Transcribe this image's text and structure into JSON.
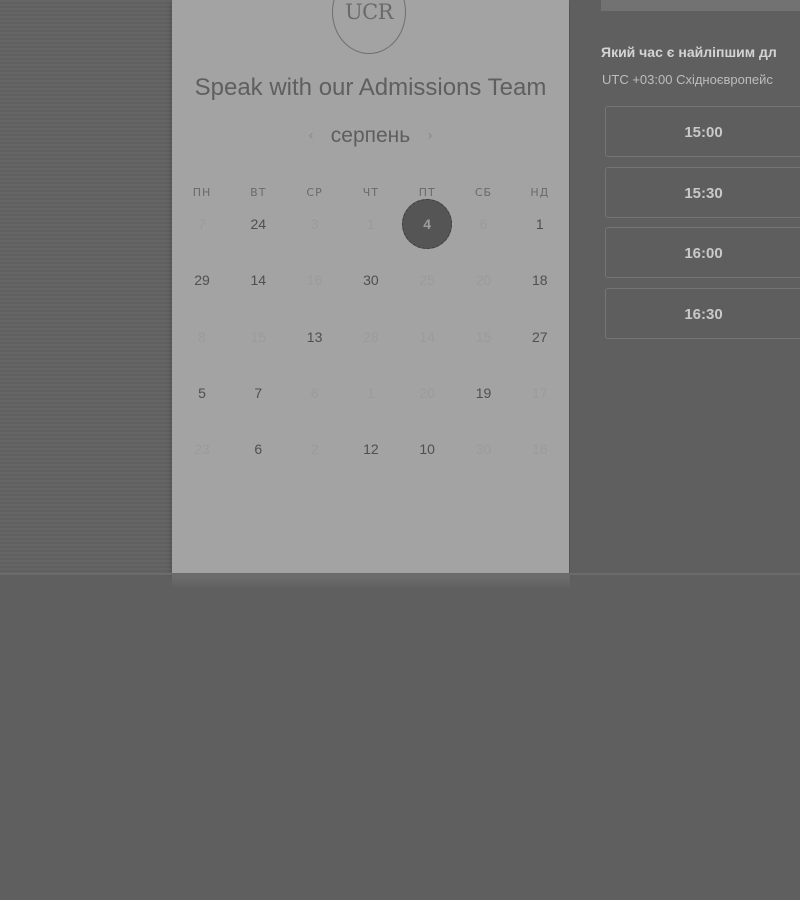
{
  "logo": {
    "text": "UCR"
  },
  "heading": "Speak with our Admissions Team",
  "calendar": {
    "month": "серпень",
    "prev_icon": "chevron-left-icon",
    "next_icon": "chevron-right-icon",
    "weekdays": [
      "ПН",
      "ВТ",
      "СР",
      "ЧТ",
      "ПТ",
      "СБ",
      "НД"
    ],
    "weeks": [
      [
        {
          "d": "7",
          "m": true
        },
        {
          "d": "24",
          "m": false
        },
        {
          "d": "3",
          "m": true
        },
        {
          "d": "1",
          "m": true
        },
        {
          "d": "4",
          "m": false,
          "sel": true
        },
        {
          "d": "6",
          "m": true
        },
        {
          "d": "1",
          "m": false
        }
      ],
      [
        {
          "d": "29",
          "m": false
        },
        {
          "d": "14",
          "m": false
        },
        {
          "d": "16",
          "m": true
        },
        {
          "d": "30",
          "m": false
        },
        {
          "d": "25",
          "m": true
        },
        {
          "d": "20",
          "m": true
        },
        {
          "d": "18",
          "m": false
        }
      ],
      [
        {
          "d": "8",
          "m": true
        },
        {
          "d": "15",
          "m": true
        },
        {
          "d": "13",
          "m": false
        },
        {
          "d": "28",
          "m": true
        },
        {
          "d": "14",
          "m": true
        },
        {
          "d": "15",
          "m": true
        },
        {
          "d": "27",
          "m": false
        }
      ],
      [
        {
          "d": "5",
          "m": false
        },
        {
          "d": "7",
          "m": false
        },
        {
          "d": "6",
          "m": true
        },
        {
          "d": "1",
          "m": true
        },
        {
          "d": "20",
          "m": true
        },
        {
          "d": "19",
          "m": false
        },
        {
          "d": "17",
          "m": true
        }
      ],
      [
        {
          "d": "23",
          "m": true
        },
        {
          "d": "6",
          "m": false
        },
        {
          "d": "2",
          "m": true
        },
        {
          "d": "12",
          "m": false
        },
        {
          "d": "10",
          "m": false
        },
        {
          "d": "30",
          "m": true
        },
        {
          "d": "16",
          "m": true
        }
      ]
    ]
  },
  "times": {
    "question": "Який час є найліпшим дл",
    "timezone": "UTC +03:00 Східноєвропейс",
    "slots": [
      "15:00",
      "15:30",
      "16:00",
      "16:30"
    ]
  },
  "colors": {
    "overlay_bg": "#5f5f5f",
    "card_bg": "#a3a3a3",
    "selected_day": "#555555"
  }
}
